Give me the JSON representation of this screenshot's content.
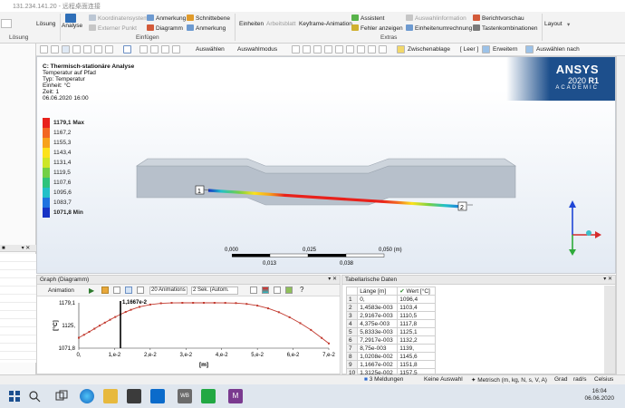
{
  "window": {
    "title": "131.234.141.20 - 远程桌面连接"
  },
  "ribbon": {
    "loesung_label": "Lösung",
    "loesung_group": "Lösung",
    "analyse_label": "Analyse",
    "koordsys": "Koordinatensystem",
    "ext_punkt": "Externer Punkt",
    "anmerkung1": "Anmerkung",
    "diagramm": "Diagramm",
    "schnittebene": "Schnittebene",
    "anmerkung2": "Anmerkung",
    "einfuegen_group": "Einfügen",
    "einheiten": "Einheiten",
    "arbeitsblatt": "Arbeitsblatt",
    "keyframe": "Keyframe-Animation",
    "assistent": "Assistent",
    "fehler": "Fehler anzeigen",
    "extras_group": "Extras",
    "auswahlinfo": "Auswahlinformation",
    "einheitenumr": "Einheitenumrechnung",
    "berichtvorschau": "Berichtvorschau",
    "tastenkomb": "Tastenkombinationen",
    "layout": "Layout"
  },
  "toolbar": {
    "auswaehlen": "Auswählen",
    "auswahlmodus": "Auswahlmodus",
    "zwischenablage": "Zwischenablage",
    "leer": "[ Leer ]",
    "erweitern": "Erweitern",
    "auswaehlen_nach": "Auswählen nach"
  },
  "viewport": {
    "analysis_title": "C: Thermisch-stationäre Analyse",
    "line2": "Temperatur auf Pfad",
    "line3": "Typ: Temperatur",
    "line4": "Einheit: °C",
    "line5": "Zeit: 1",
    "line6": "06.06.2020 16:00",
    "brand": "ANSYS",
    "version_prefix": "2020 ",
    "version_bold": "R1",
    "edition": "ACADEMIC",
    "probe1": "1",
    "probe2": "2"
  },
  "legend": [
    {
      "label": "1179,1 Max",
      "color": "#e8211b",
      "bold": true
    },
    {
      "label": "1167,2",
      "color": "#f26622"
    },
    {
      "label": "1155,3",
      "color": "#f7a21b"
    },
    {
      "label": "1143,4",
      "color": "#fce21b"
    },
    {
      "label": "1131,4",
      "color": "#cde627"
    },
    {
      "label": "1119,5",
      "color": "#73d046"
    },
    {
      "label": "1107,6",
      "color": "#2fc37b"
    },
    {
      "label": "1095,6",
      "color": "#22c0c8"
    },
    {
      "label": "1083,7",
      "color": "#1f73e0"
    },
    {
      "label": "1071,8 Min",
      "color": "#1733c5",
      "bold": true
    }
  ],
  "scale": {
    "t0": "0,000",
    "t1": "0,025",
    "t2": "0,050 (m)",
    "b1": "0,013",
    "b2": "0,038"
  },
  "graph": {
    "title": "Graph (Diagramm)",
    "animation": "Animation",
    "anim_count": "20 Animations",
    "anim_time": "2 Sek. (Autom.",
    "marker": "1,1667e-2"
  },
  "chart_data": {
    "type": "line",
    "title": "",
    "xlabel": "[m]",
    "ylabel": "[°C]",
    "xlim": [
      0,
      0.07
    ],
    "ylim": [
      1071.8,
      1179.1
    ],
    "xticks": [
      "0,",
      "1,e-2",
      "2,e-2",
      "3,e-2",
      "4,e-2",
      "5,e-2",
      "6,e-2",
      "7,e-2"
    ],
    "yticks": [
      "1179,1",
      "1125,",
      "1071,8"
    ],
    "series": [
      {
        "name": "",
        "x": [
          0,
          0.0014583,
          0.0029167,
          0.004375,
          0.0058333,
          0.0072917,
          0.00875,
          0.010208,
          0.011667,
          0.013125,
          0.014583,
          0.017,
          0.02,
          0.023,
          0.026,
          0.029,
          0.032,
          0.035,
          0.038,
          0.041,
          0.044,
          0.047,
          0.05,
          0.053,
          0.056,
          0.059,
          0.062,
          0.065,
          0.068,
          0.07
        ],
        "values": [
          1096.4,
          1103.4,
          1110.5,
          1117.8,
          1125.1,
          1132.2,
          1139.0,
          1145.6,
          1151.8,
          1157.5,
          1162.6,
          1169.5,
          1175.0,
          1178.0,
          1179.0,
          1179.1,
          1179.1,
          1179.1,
          1179.1,
          1179.0,
          1178.5,
          1176.5,
          1172.5,
          1166.0,
          1157.0,
          1145.0,
          1131.0,
          1115.0,
          1096.0,
          1083.0
        ]
      }
    ],
    "grid": false,
    "marker_x": 0.011667
  },
  "table": {
    "title": "Tabellarische Daten",
    "col_len": "Länge [m]",
    "col_val": "Wert [°C]",
    "rows": [
      [
        "1",
        "0,",
        "1096,4"
      ],
      [
        "2",
        "1,4583e-003",
        "1103,4"
      ],
      [
        "3",
        "2,9167e-003",
        "1110,5"
      ],
      [
        "4",
        "4,375e-003",
        "1117,8"
      ],
      [
        "5",
        "5,8333e-003",
        "1125,1"
      ],
      [
        "6",
        "7,2917e-003",
        "1132,2"
      ],
      [
        "7",
        "8,75e-003",
        "1139,"
      ],
      [
        "8",
        "1,0208e-002",
        "1145,6"
      ],
      [
        "9",
        "1,1667e-002",
        "1151,8"
      ],
      [
        "10",
        "1,3125e-002",
        "1157,5"
      ],
      [
        "11",
        "1,4583e-003",
        "1162,6"
      ]
    ]
  },
  "status": {
    "messages": "3 Meldungen",
    "selection": "Keine Auswahl",
    "units": "Metrisch (m, kg, N, s, V, A)",
    "grad": "Grad",
    "rads": "rad/s",
    "celsius": "Celsius"
  },
  "taskbar": {
    "time": "16:04",
    "date": "06.06.2020",
    "wb": "WB"
  }
}
